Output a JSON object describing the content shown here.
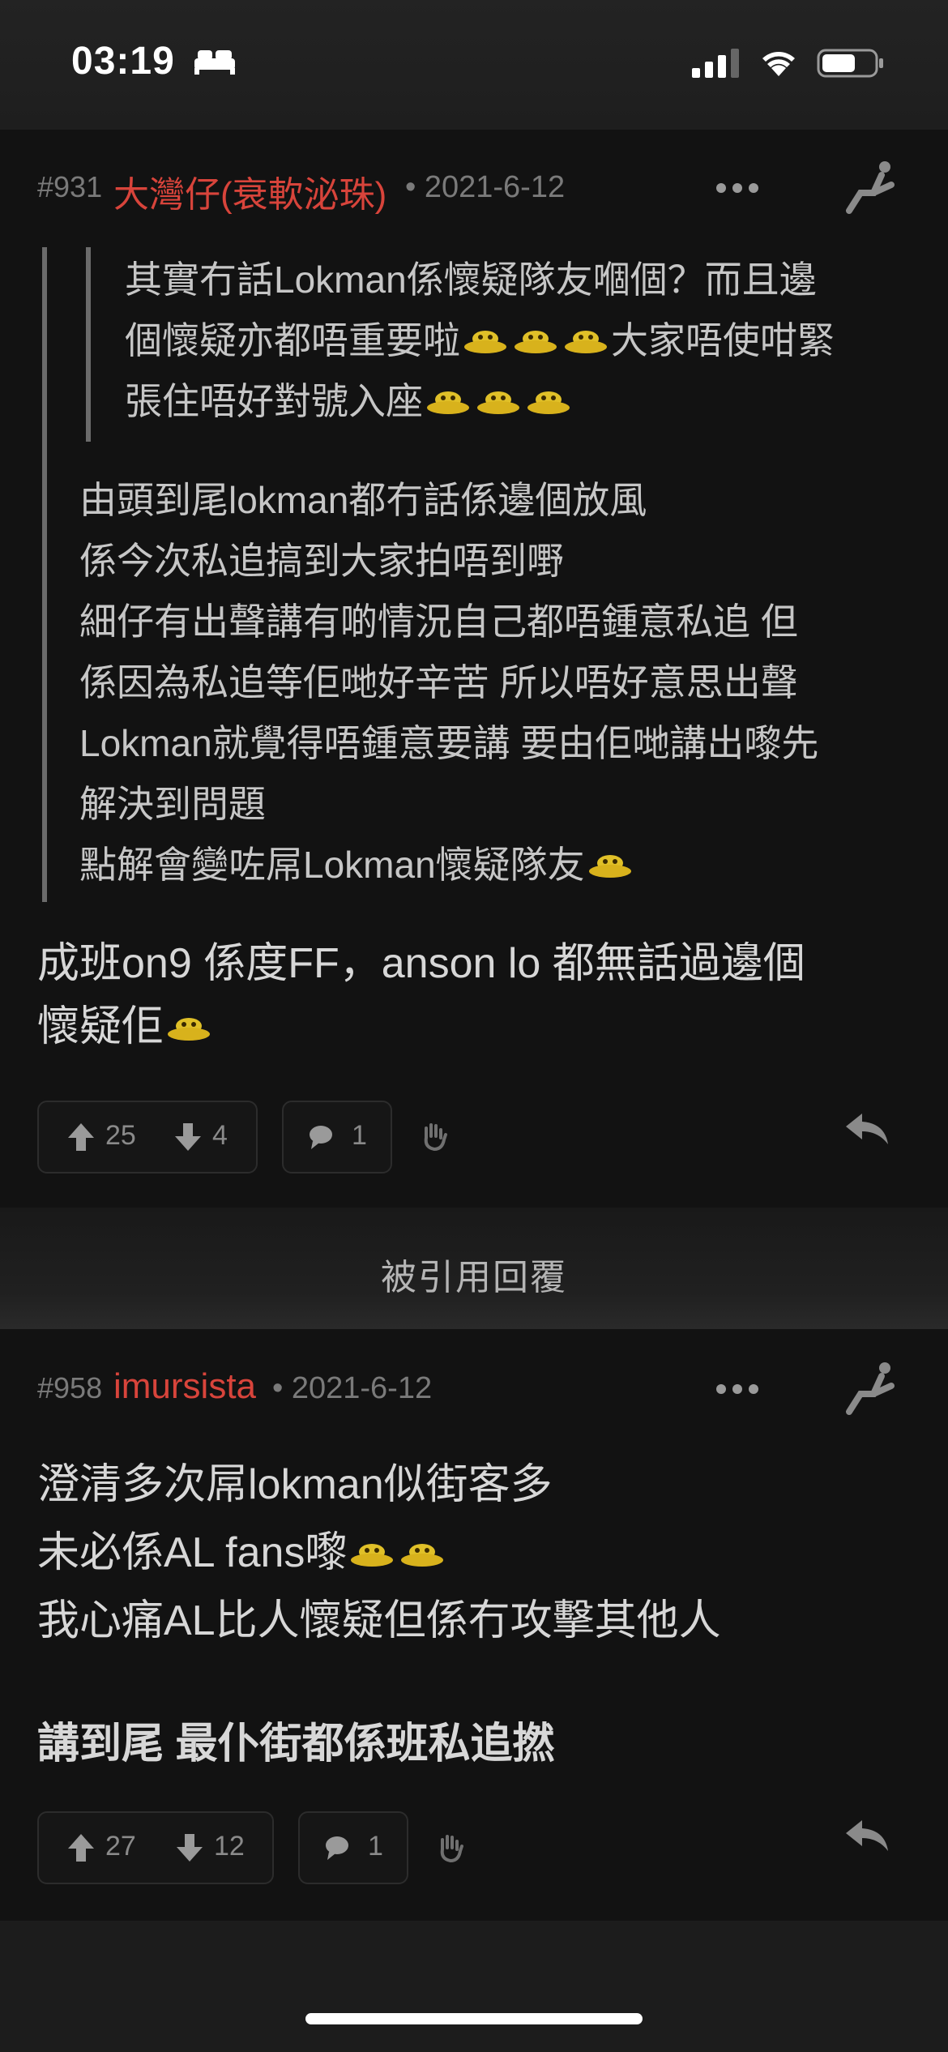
{
  "status_bar": {
    "time": "03:19"
  },
  "posts": [
    {
      "number": "#931",
      "username": "大灣仔(衰軟泌珠)",
      "date": "• 2021-6-12",
      "nested_quote": [
        "其實冇話Lokman係懷疑隊友嗰個？而且邊",
        "個懷疑亦都唔重要啦",
        "大家唔使咁緊",
        "張住唔好對號入座"
      ],
      "quote": [
        "由頭到尾lokman都冇話係邊個放風",
        "係今次私追搞到大家拍唔到嘢",
        "細仔有出聲講有啲情況自己都唔鍾意私追 但",
        "係因為私追等佢哋好辛苦 所以唔好意思出聲",
        "Lokman就覺得唔鍾意要講 要由佢哋講出嚟先",
        "解決到問題",
        "點解會變咗屌Lokman懷疑隊友"
      ],
      "body": [
        "成班on9 係度FF，anson lo 都無話過邊個",
        "懷疑佢"
      ],
      "upvotes": "25",
      "downvotes": "4",
      "comments": "1"
    },
    {
      "number": "#958",
      "username": "imursista",
      "date": "• 2021-6-12",
      "body": [
        "澄清多次屌lokman似街客多",
        "未必係AL fans嚟",
        "我心痛AL比人懷疑但係冇攻擊其他人"
      ],
      "body_bold": "講到尾 最仆街都係班私追撚",
      "upvotes": "27",
      "downvotes": "12",
      "comments": "1"
    }
  ],
  "quoted_section": {
    "label": "被引用回覆"
  }
}
